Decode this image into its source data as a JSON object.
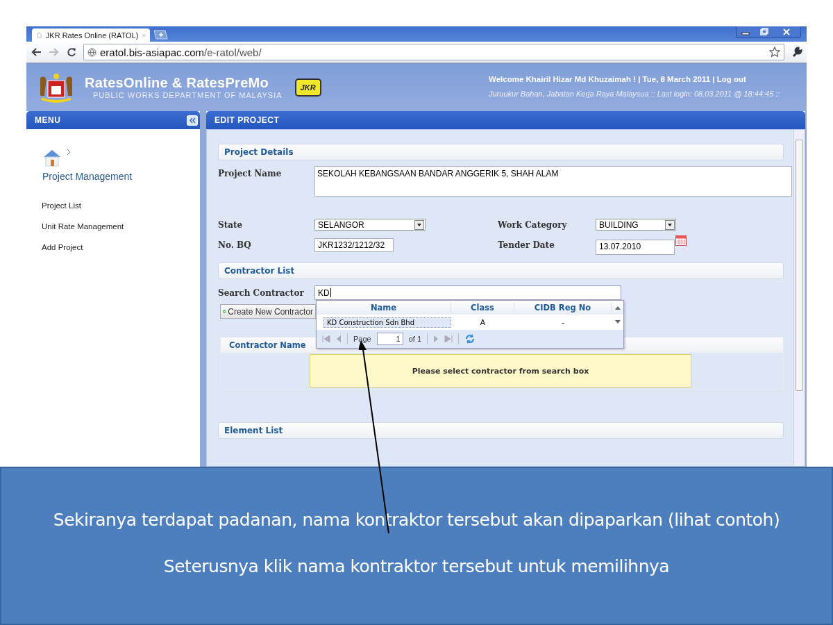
{
  "browser": {
    "tab_title": "JKR Rates Online (RATOL)",
    "url_host": "eratol.bis-asiapac.com",
    "url_path": "/e-ratol/web/"
  },
  "header": {
    "title": "RatesOnline & RatesPreMo",
    "subtitle": "PUBLIC WORKS DEPARTMENT OF MALAYSIA",
    "badge": "JKR",
    "welcome": "Welcome Khairil Hizar Md Khuzaimah ! | Tue, 8 March 2011 | Log out",
    "login_info": "Juruukur Bahan, Jabatan Kerja Raya Malaysua :: Last login: 08.03.2011 @ 18:44:45 ::"
  },
  "sidebar": {
    "title": "MENU",
    "breadcrumb": "Project Management",
    "items": [
      "Project List",
      "Unit Rate Management",
      "Add Project"
    ]
  },
  "main": {
    "title": "EDIT PROJECT",
    "project_details": {
      "heading": "Project Details",
      "project_name_label": "Project Name",
      "project_name": "SEKOLAH KEBANGSAAN BANDAR ANGGERIK 5, SHAH ALAM",
      "state_label": "State",
      "state": "SELANGOR",
      "work_category_label": "Work Category",
      "work_category": "BUILDING",
      "no_bq_label": "No. BQ",
      "no_bq": "JKR1232/1212/32",
      "tender_date_label": "Tender Date",
      "tender_date": "13.07.2010"
    },
    "contractor_list": {
      "heading": "Contractor List",
      "search_label": "Search Contractor",
      "search_value": "KD",
      "create_button": "Create New Contractor",
      "results": {
        "columns": [
          "Name",
          "Class",
          "CIDB Reg No"
        ],
        "rows": [
          {
            "cells": [
              "KD Construction Sdn Bhd",
              "A",
              "-"
            ],
            "selected": true
          }
        ],
        "pager": {
          "label": "Page",
          "page": "1",
          "of": "of 1"
        }
      },
      "contractor_name_heading": "Contractor Name",
      "message": "Please select contractor from search box"
    },
    "element_list": {
      "heading": "Element List"
    }
  },
  "caption": [
    "Sekiranya terdapat padanan, nama kontraktor tersebut akan dipaparkan (lihat contoh)",
    "Seterusnya klik nama kontraktor tersebut untuk memilihnya"
  ]
}
